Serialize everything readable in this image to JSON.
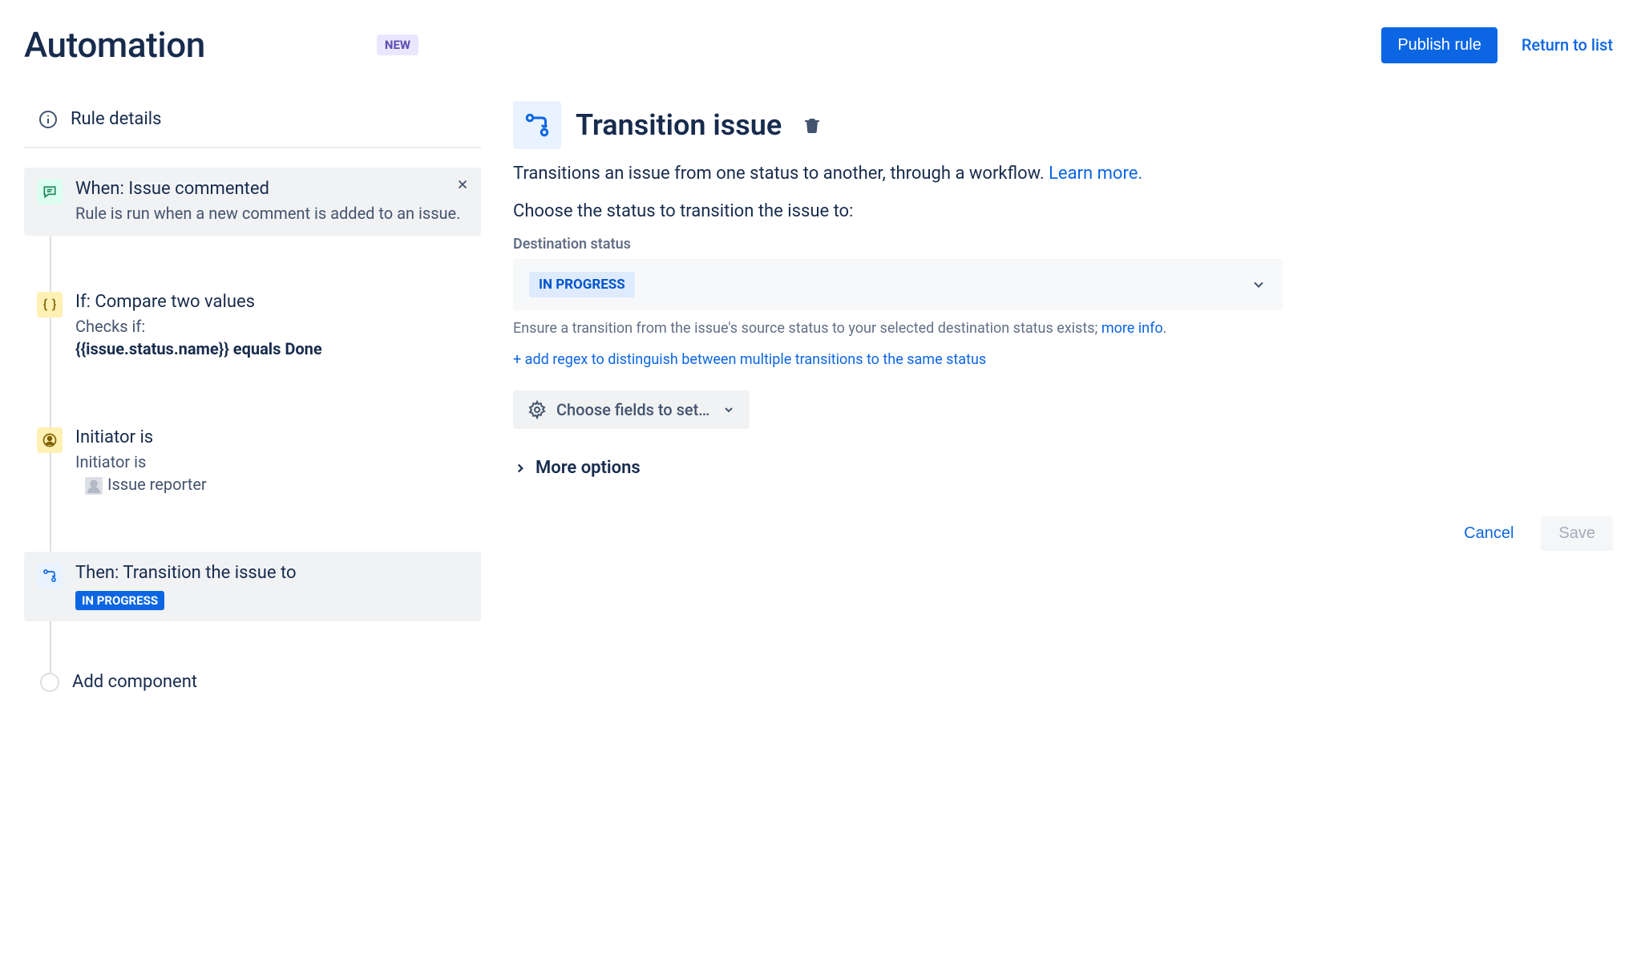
{
  "header": {
    "title": "Automation",
    "badge": "NEW",
    "publish_label": "Publish rule",
    "return_label": "Return to list"
  },
  "sidebar": {
    "rule_details_label": "Rule details",
    "steps": [
      {
        "title": "When: Issue commented",
        "desc": "Rule is run when a new comment is added to an issue."
      },
      {
        "title": "If: Compare two values",
        "desc_prefix": "Checks if:",
        "desc_bold": "{{issue.status.name}} equals Done"
      },
      {
        "title": "Initiator is",
        "desc_prefix": "Initiator is",
        "desc_value": "Issue reporter"
      },
      {
        "title": "Then: Transition the issue to",
        "status": "IN PROGRESS"
      }
    ],
    "add_component_label": "Add component"
  },
  "main": {
    "title": "Transition issue",
    "description": "Transitions an issue from one status to another, through a workflow. ",
    "learn_more": "Learn more.",
    "choose_label": "Choose the status to transition the issue to:",
    "dest_status_label": "Destination status",
    "dest_status_value": "IN PROGRESS",
    "helper_text_prefix": "Ensure a transition from the issue's source status to your selected destination status exists; ",
    "helper_text_link": "more info",
    "regex_link": "+ add regex to distinguish between multiple transitions to the same status",
    "choose_fields_label": "Choose fields to set…",
    "more_options_label": "More options",
    "cancel_label": "Cancel",
    "save_label": "Save"
  }
}
